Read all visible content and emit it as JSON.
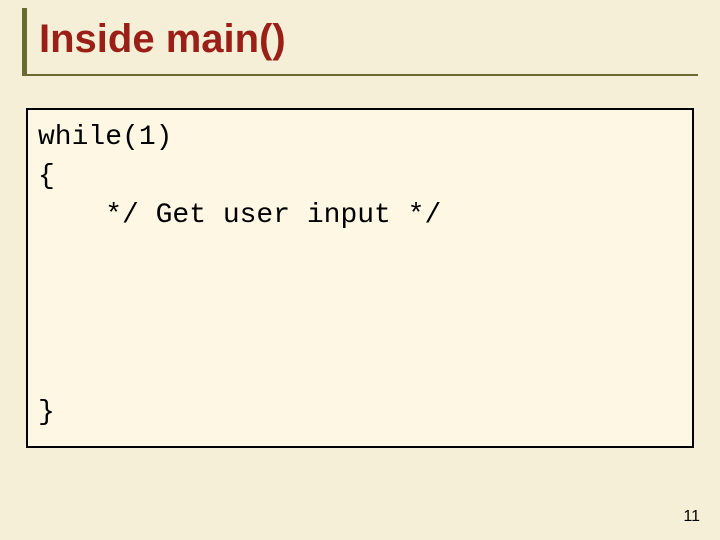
{
  "title": "Inside main()",
  "code": {
    "line1": "while(1)",
    "line2": "{",
    "line3": "    */ Get user input */",
    "close": "}"
  },
  "page_number": "11"
}
